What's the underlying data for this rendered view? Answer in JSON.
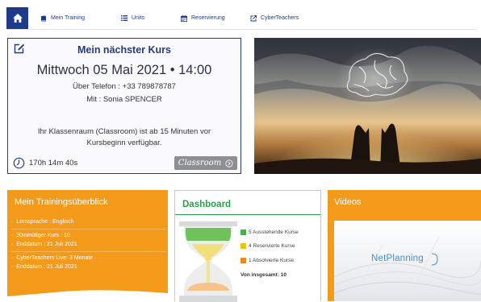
{
  "nav": {
    "items": [
      {
        "label": "Mein Training",
        "icon": "book-icon"
      },
      {
        "label": "Units",
        "icon": "list-icon"
      },
      {
        "label": "Reservierung",
        "icon": "calendar-icon"
      },
      {
        "label": "CyberTeachers",
        "icon": "external-link-icon"
      }
    ]
  },
  "course": {
    "title": "Mein nächster Kurs",
    "date": "Mittwoch 05 Mai 2021 • 14:00",
    "phone": "Über Telefon : +33 789878787",
    "teacher": "Mit : Sonia SPENCER",
    "note_line1": "Ihr Klassenraum (Classroom) ist ab 15 Minuten vor",
    "note_line2": "Kursbeginn verfügbar.",
    "countdown": "170h 14m 40s",
    "classroom_button": "Classroom"
  },
  "overview": {
    "title": "Mein Trainingsüberblick",
    "rows": [
      "Lernsprache : Englisch",
      "30minütiger Kurs : 10",
      "Enddatum : 21 Juli 2021",
      "CyberTeachers Live: 3 Monate",
      "Enddatum : 21 Juli 2021"
    ]
  },
  "dashboard": {
    "title": "Dashboard",
    "legend": [
      {
        "label": "5 Ausstehende Kurse",
        "color": "#3fb54a"
      },
      {
        "label": "4 Reservierte Kurse",
        "color": "#e8c41a"
      },
      {
        "label": "1 Absolvierte Kurse",
        "color": "#e98a26"
      }
    ],
    "total": "Von insgesamt: 10"
  },
  "videos": {
    "title": "Videos",
    "thumb_label": "NetPlanning"
  },
  "colors": {
    "primary": "#1e3a8a",
    "orange": "#f49a1a",
    "green": "#25a24a",
    "button_gray": "#8d8f93"
  }
}
